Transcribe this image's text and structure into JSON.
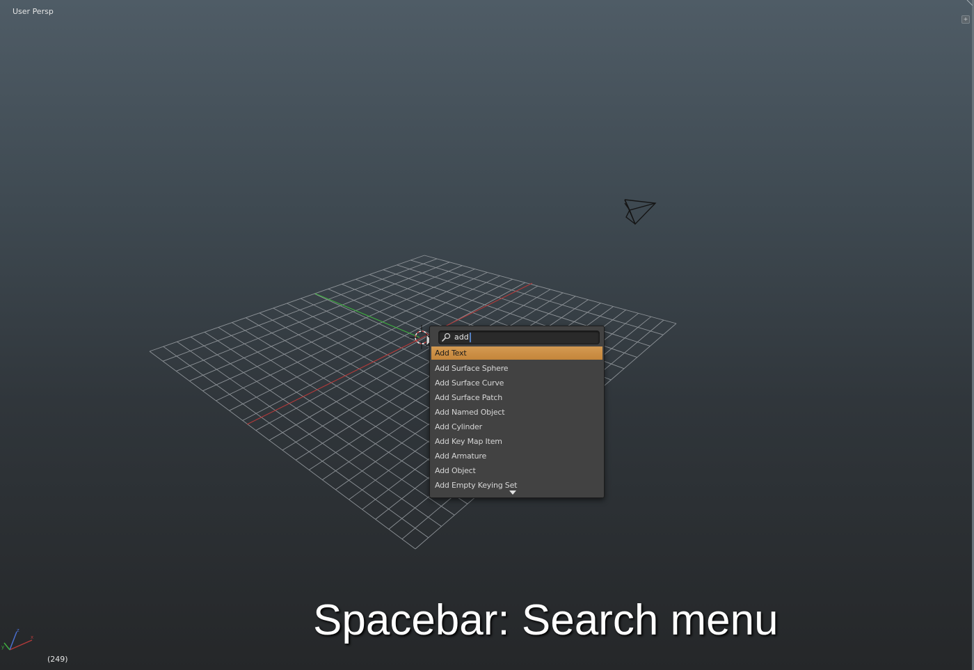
{
  "viewport": {
    "view_label": "User Persp",
    "frame_label": "(249)"
  },
  "search_menu": {
    "query": "add",
    "results": [
      "Add Text",
      "Add Surface Sphere",
      "Add Surface Curve",
      "Add Surface Patch",
      "Add Named Object",
      "Add Cylinder",
      "Add Key Map Item",
      "Add Armature",
      "Add Object",
      "Add Empty Keying Set"
    ],
    "active_index": 0
  },
  "caption": "Spacebar: Search menu",
  "icons": {
    "search": "search-icon",
    "camera": "camera-icon",
    "cursor": "3d-cursor-icon",
    "mouse": "mouse-pointer-icon",
    "scroll": "scroll-down-icon",
    "axes": "axis-gizmo-icon"
  },
  "colors": {
    "highlight": "#d49a52",
    "x_axis": "#b33a3a",
    "y_axis": "#3fae3f",
    "grid": "#8e9398"
  }
}
